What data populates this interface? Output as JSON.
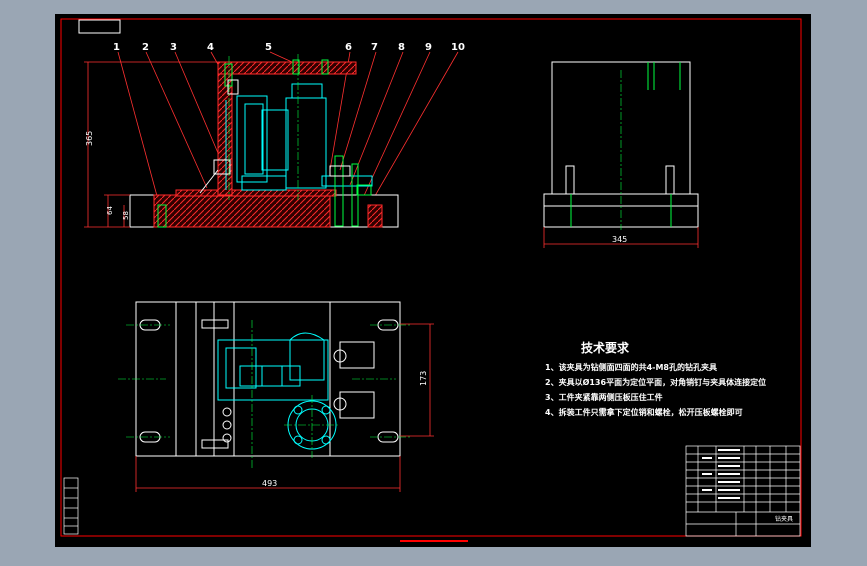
{
  "drawing": {
    "part_labels": [
      "1",
      "2",
      "3",
      "4",
      "5",
      "6",
      "7",
      "8",
      "9",
      "10"
    ],
    "dimensions": {
      "front_height": "365",
      "front_base_1": "64",
      "front_base_2": "58",
      "side_width": "345",
      "plan_width": "493",
      "plan_depth": "173"
    },
    "tech_requirements": {
      "title": "技术要求",
      "items": [
        "1、该夹具为钻侧面四面的共4-M8孔的钻孔夹具",
        "2、夹具以Ø136平面为定位平面，对角销钉与夹具体连接定位",
        "3、工件夹紧靠两侧压板压住工件",
        "4、拆装工件只需拿下定位销和螺栓，松开压板螺栓即可"
      ]
    },
    "title_block": {
      "drawing_name": "钻夹具"
    },
    "colors": {
      "background": "#000000",
      "frame": "#ff0000",
      "outline": "#ffffff",
      "part": "#00ffff",
      "center": "#00ff00",
      "dimension": "#ff3030",
      "hatch": "#ff2020",
      "text": "#ffffff"
    }
  }
}
